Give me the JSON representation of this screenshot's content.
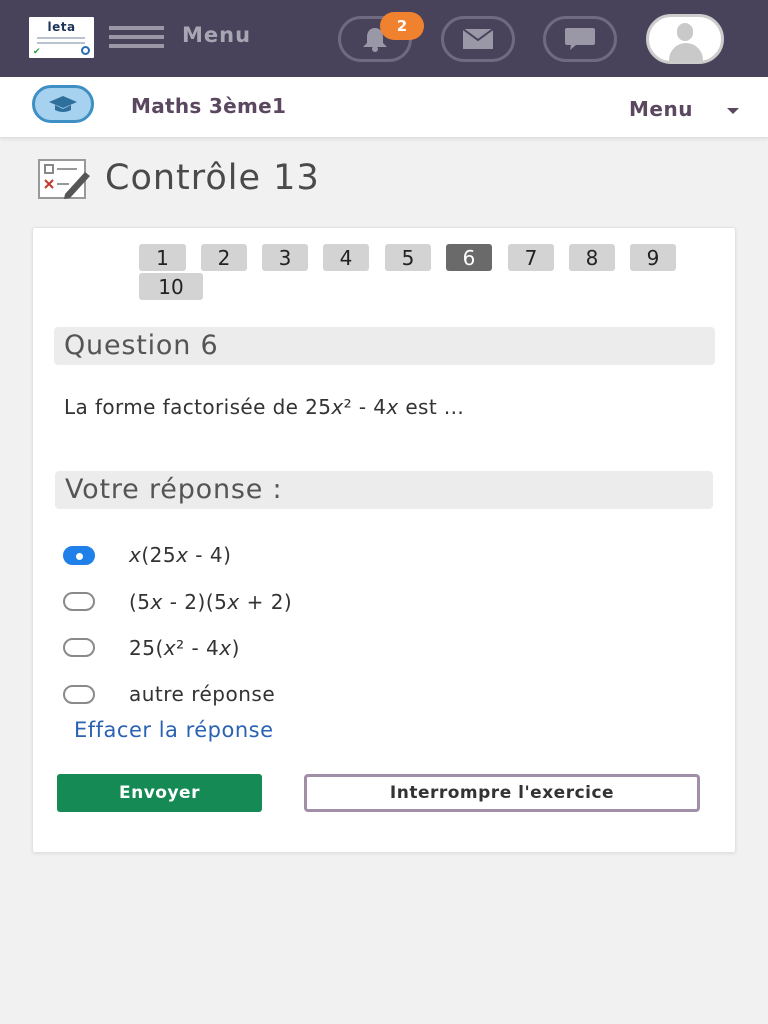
{
  "topbar": {
    "logo_text": "leta",
    "menu_label": "Menu",
    "notification_count": "2",
    "icons": [
      "hamburger-icon",
      "bell-icon",
      "mail-icon",
      "chat-icon",
      "user-avatar-icon"
    ]
  },
  "subbar": {
    "course_title": "Maths 3ème1",
    "menu_label": "Menu",
    "icons": [
      "graduation-cap-icon",
      "caret-down-icon"
    ]
  },
  "page": {
    "title": "Contrôle 13",
    "icon": "checklist-edit-icon"
  },
  "question_nav": {
    "items": [
      "1",
      "2",
      "3",
      "4",
      "5",
      "6",
      "7",
      "8",
      "9",
      "10"
    ],
    "active": "6"
  },
  "question": {
    "heading": "Question 6",
    "text_prefix": "La forme factorisée de 25",
    "text_var1": "x",
    "text_mid": "² - 4",
    "text_var2": "x",
    "text_suffix": " est ..."
  },
  "answer": {
    "heading": "Votre réponse :",
    "options": [
      {
        "id": "a",
        "parts": [
          "x",
          "(25",
          "x",
          " - 4)"
        ],
        "selected": true
      },
      {
        "id": "b",
        "parts": [
          "(5",
          "x",
          " - 2)(5",
          "x",
          " + 2)"
        ],
        "selected": false
      },
      {
        "id": "c",
        "parts": [
          "25(",
          "x",
          "² - 4",
          "x",
          ")"
        ],
        "selected": false
      },
      {
        "id": "d",
        "parts": [
          "autre réponse"
        ],
        "selected": false
      }
    ],
    "clear_label": "Effacer la réponse"
  },
  "actions": {
    "send_label": "Envoyer",
    "stop_label": "Interrompre l'exercice"
  },
  "colors": {
    "topbar": "#48425a",
    "badge": "#f0822f",
    "send_button": "#158a55",
    "radio_selected": "#1e80e8",
    "link": "#2a63b3",
    "course_title": "#5b4760"
  }
}
